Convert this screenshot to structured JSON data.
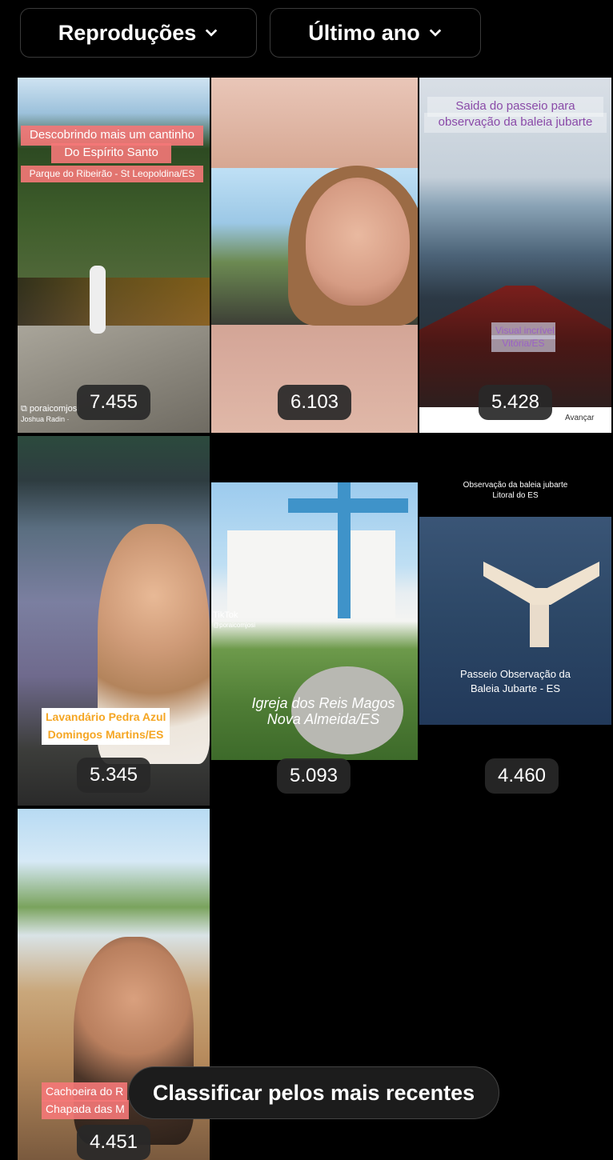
{
  "filters": {
    "metric_label": "Reproduções",
    "period_label": "Último ano"
  },
  "grid": {
    "items": [
      {
        "count": "7.455",
        "caption_1": "Descobrindo mais um cantinho",
        "caption_2": "Do Espírito Santo",
        "caption_3": "Parque do Ribeirão - St Leopoldina/ES",
        "watermark": "poraicomjosi",
        "watermark_sub": "Joshua Radin · "
      },
      {
        "count": "6.103"
      },
      {
        "count": "5.428",
        "caption_1": "Saida do passeio para",
        "caption_2": "observação da  baleia jubarte",
        "caption_3": "Visual incrível",
        "caption_4": "Vitória/ES",
        "overlay_label": "Avançar"
      },
      {
        "count": "5.345",
        "caption_1": "Lavandário Pedra Azul",
        "caption_2": "Domingos Martins/ES"
      },
      {
        "count": "5.093",
        "caption_1": "Igreja dos Reis Magos",
        "caption_2": "Nova Almeida/ES",
        "watermark": "TikTok",
        "watermark_sub": "@poraicomjosi"
      },
      {
        "count": "4.460",
        "caption_1": "Observação da baleia jubarte",
        "caption_2": "Litoral do ES",
        "caption_3": "Passeio Observação da",
        "caption_4": "Baleia Jubarte - ES"
      },
      {
        "count": "4.451",
        "caption_1": "Cachoeira do R",
        "caption_2": "Chapada das M"
      }
    ]
  },
  "sort_button": {
    "label": "Classificar pelos mais recentes"
  }
}
